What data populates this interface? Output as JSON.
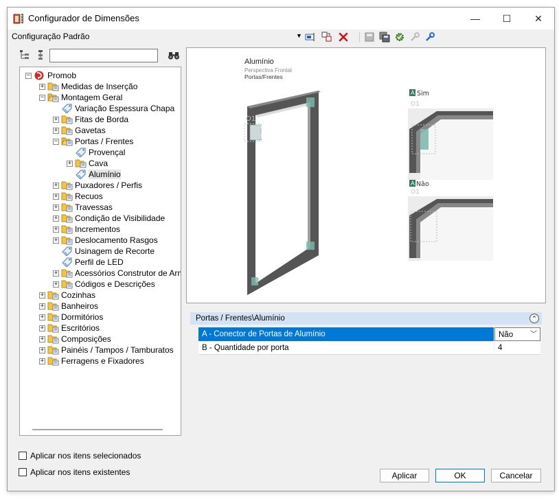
{
  "window": {
    "title": "Configurador de Dimensões",
    "min_glyph": "—",
    "max_glyph": "☐",
    "close_glyph": "✕"
  },
  "config": {
    "label": "Configuração Padrão",
    "dropdown_glyph": "▼"
  },
  "tree": {
    "search_value": "",
    "items": [
      {
        "label": "Promob",
        "depth": 0,
        "icon": "promob-logo-icon",
        "expander": "−"
      },
      {
        "label": "Medidas de Inserção",
        "depth": 1,
        "icon": "folder-icon",
        "expander": "+"
      },
      {
        "label": "Montagem Geral",
        "depth": 1,
        "icon": "folder-open-icon",
        "expander": "−"
      },
      {
        "label": "Variação Espessura Chapa",
        "depth": 2,
        "icon": "tag-icon",
        "expander": ""
      },
      {
        "label": "Fitas de Borda",
        "depth": 2,
        "icon": "folder-icon",
        "expander": "+"
      },
      {
        "label": "Gavetas",
        "depth": 2,
        "icon": "folder-icon",
        "expander": "+"
      },
      {
        "label": "Portas / Frentes",
        "depth": 2,
        "icon": "folder-open-icon",
        "expander": "−"
      },
      {
        "label": "Provençal",
        "depth": 3,
        "icon": "tag-icon",
        "expander": ""
      },
      {
        "label": "Cava",
        "depth": 3,
        "icon": "folder-icon",
        "expander": "+"
      },
      {
        "label": "Alumínio",
        "depth": 3,
        "icon": "tag-icon",
        "expander": "",
        "selected": true
      },
      {
        "label": "Puxadores / Perfis",
        "depth": 2,
        "icon": "folder-icon",
        "expander": "+"
      },
      {
        "label": "Recuos",
        "depth": 2,
        "icon": "folder-icon",
        "expander": "+"
      },
      {
        "label": "Travessas",
        "depth": 2,
        "icon": "folder-icon",
        "expander": "+"
      },
      {
        "label": "Condição de Visibilidade",
        "depth": 2,
        "icon": "folder-icon",
        "expander": "+"
      },
      {
        "label": "Incrementos",
        "depth": 2,
        "icon": "folder-icon",
        "expander": "+"
      },
      {
        "label": "Deslocamento Rasgos",
        "depth": 2,
        "icon": "folder-icon",
        "expander": "+"
      },
      {
        "label": "Usinagem de Recorte",
        "depth": 2,
        "icon": "tag-icon",
        "expander": ""
      },
      {
        "label": "Perfil de LED",
        "depth": 2,
        "icon": "tag-icon",
        "expander": ""
      },
      {
        "label": "Acessórios Construtor de Armário",
        "depth": 2,
        "icon": "folder-icon",
        "expander": "+"
      },
      {
        "label": "Códigos e Descrições",
        "depth": 2,
        "icon": "folder-icon",
        "expander": "+"
      },
      {
        "label": "Cozinhas",
        "depth": 1,
        "icon": "folder-icon",
        "expander": "+"
      },
      {
        "label": "Banheiros",
        "depth": 1,
        "icon": "folder-icon",
        "expander": "+"
      },
      {
        "label": "Dormitórios",
        "depth": 1,
        "icon": "folder-icon",
        "expander": "+"
      },
      {
        "label": "Escritórios",
        "depth": 1,
        "icon": "folder-icon",
        "expander": "+"
      },
      {
        "label": "Composições",
        "depth": 1,
        "icon": "folder-icon",
        "expander": "+"
      },
      {
        "label": "Painéis / Tampos / Tamburatos",
        "depth": 1,
        "icon": "folder-icon",
        "expander": "+"
      },
      {
        "label": "Ferragens e Fixadores",
        "depth": 1,
        "icon": "folder-icon",
        "expander": "+"
      }
    ]
  },
  "options": {
    "apply_selected": "Aplicar nos itens selecionados",
    "apply_existing": "Aplicar nos itens existentes"
  },
  "preview": {
    "title": "Alumínio",
    "subtitle": "Perspectiva Frontal",
    "category": "Portas/Frentes",
    "door_label": "O1",
    "opt_a_badge": "A",
    "opt_yes_label": "Sim",
    "opt_yes_code": "O1",
    "opt_no_badge": "A",
    "opt_no_label": "Não",
    "opt_no_code": "O1"
  },
  "props": {
    "header": "Portas / Frentes\\Alumínio",
    "collapse_glyph": "⌃",
    "rows": [
      {
        "name": "A - Conector de Portas de Alumínio",
        "value": "Não",
        "dropdown_glyph": "﹀"
      },
      {
        "name": "B - Quantidade por porta",
        "value": "4"
      }
    ]
  },
  "buttons": {
    "apply": "Aplicar",
    "ok": "OK",
    "cancel": "Cancelar"
  },
  "colors": {
    "accent": "#0078d7",
    "header_bg": "#d3e2f4",
    "folder": "#f5c542"
  }
}
